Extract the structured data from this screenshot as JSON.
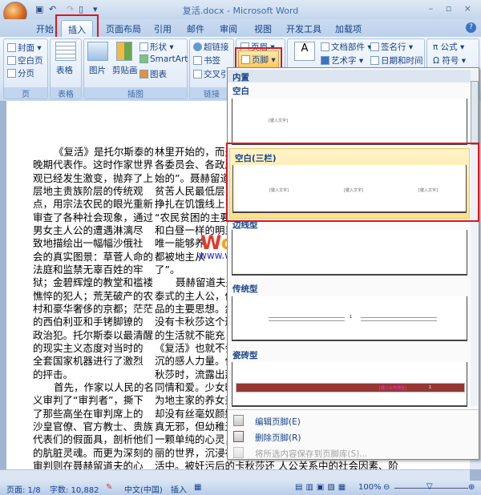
{
  "window": {
    "title": "复活.docx - Microsoft Word",
    "controls": "– ▫ ×"
  },
  "qat": {
    "save_icon": "save-icon",
    "undo_icon": "undo-icon",
    "redo_icon": "redo-icon",
    "new_icon": "new-doc-icon"
  },
  "tabs": [
    "开始",
    "插入",
    "页面布局",
    "引用",
    "邮件",
    "审阅",
    "视图",
    "开发工具",
    "加载项"
  ],
  "active_tab": "插入",
  "ribbon": {
    "page": {
      "label": "页",
      "items": [
        "封面 ▾",
        "空白页",
        "分页"
      ]
    },
    "table": {
      "label": "表格",
      "items": [
        "表格"
      ]
    },
    "illustrations": {
      "label": "插图",
      "items": [
        "图片",
        "剪贴画",
        "形状 ▾",
        "SmartArt",
        "图表"
      ]
    },
    "links": {
      "label": "链接",
      "items": [
        "超链接",
        "书签",
        "交叉引"
      ]
    },
    "header_footer": {
      "items": [
        "页眉 ▾",
        "页脚 ▾"
      ]
    },
    "text": {
      "items": [
        "文档部件 ▾",
        "艺术字 ▾",
        "签名行 ▾",
        "日期和时间",
        "A"
      ]
    },
    "symbols": {
      "items": [
        "π 公式 ▾",
        "Ω 符号 ▾"
      ]
    }
  },
  "document": {
    "left_column": [
      "《复活》是托尔斯泰的",
      "晚期代表作。这时作家世界",
      "观已经发生激变，抛弃了上",
      "层地主贵族阶层的传统观",
      "点，用宗法农民的眼光重新",
      "审查了各种社会现象，通过",
      "男女主人公的遭遇淋漓尽",
      "致地描绘出一幅幅沙俄社",
      "会的真实图景：草菅人命的",
      "法庭和监禁无辜百姓的牢",
      "狱；金碧辉煌的教堂和褴褛",
      "憔悴的犯人；荒芜破产的农",
      "村和豪华奢侈的京都；茫茫",
      "的西伯利亚和手铐脚镣的",
      "政治犯。托尔斯泰以最清醒",
      "的现实主义态度对当时的",
      "全套国家机器进行了激烈",
      "的抨击。",
      "首先，作家以人民的名",
      "义审判了“审判者”，撕下",
      "了那些高坐在审判席上的",
      "沙皇官僚、官方教士、贵族",
      "代表们的假面具，剖析他们",
      "的肮脏灵魂。而更为深刻的",
      "审判则在聂赫留道夫的心"
    ],
    "right_column": [
      "林里开始的，而是",
      "各委员会、各政府",
      "始的”。聂赫留道",
      "贫苦人民最低层，",
      "挣扎在饥饿线上，",
      "“农民贫困的主要",
      "和白昼一样的明显",
      "唯一能够养",
      "都被地主从",
      "了”。",
      "聂赫留道夫是",
      "泰式的主人公，他",
      "品的主要思想。然",
      "没有卡秋莎这个形",
      "的生活就不能充",
      "《复活》也就不会",
      "沉的感人力量。作",
      "秋莎时，流露出那",
      "同情和爱。少女时",
      "为地主家的养女兼",
      "却没有丝毫奴颜婢",
      "真无邪，但幼稚无",
      "一颗单纯的心灵，",
      "丽的世界，沉浸在",
      "活中。被奸污后的卡秋莎还      人公关系中的社会因素、阶"
    ]
  },
  "watermark": {
    "logo": "Word联盟",
    "url": "www.wordlm.com"
  },
  "footer_menu": {
    "category": "内置",
    "gallery": [
      {
        "name": "空白",
        "placeholders": [
          "[键入文字]"
        ]
      },
      {
        "name": "空白(三栏)",
        "placeholders": [
          "[键入文字]",
          "[键入文字]",
          "[键入文字]"
        ],
        "highlighted": true
      },
      {
        "name": "边线型"
      },
      {
        "name": "传统型",
        "page_number": "1"
      },
      {
        "name": "瓷砖型",
        "placeholders": [
          "[键入公司地址]"
        ],
        "page_number": "1"
      }
    ],
    "commands": [
      {
        "label": "编辑页脚(E)",
        "enabled": true
      },
      {
        "label": "删除页脚(R)",
        "enabled": true
      },
      {
        "label": "将所选内容保存到页脚库(S)...",
        "enabled": false
      }
    ]
  },
  "status": {
    "page": "页面: 1/8",
    "words": "字数: 10,882",
    "language": "中文(中国)",
    "mode": "插入",
    "zoom": "100%",
    "zoom_percent": 100
  },
  "colors": {
    "highlight_box": "#e0151b",
    "tile_footer": "#953734",
    "ribbon_text": "#15428b"
  }
}
